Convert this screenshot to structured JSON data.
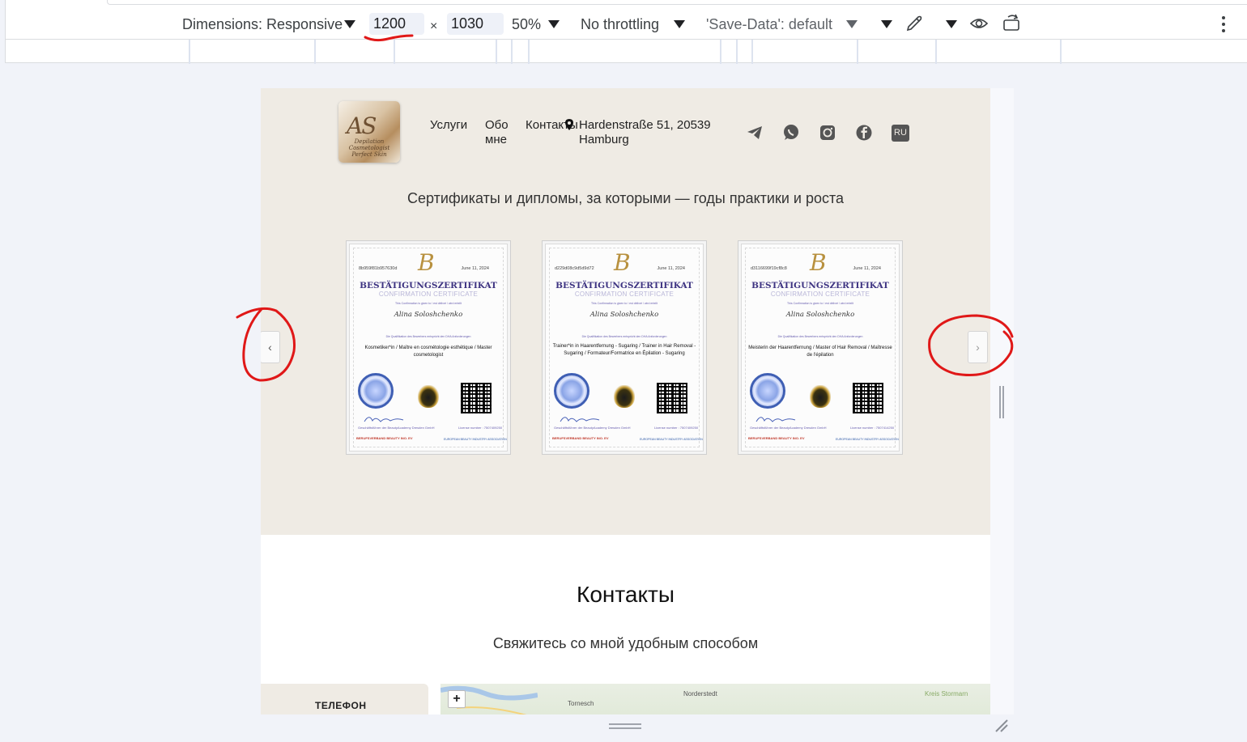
{
  "devtools": {
    "dimensions_label": "Dimensions: Responsive",
    "width_value": "1200",
    "times": "×",
    "height_value": "1030",
    "zoom": "50%",
    "throttling": "No throttling",
    "save_data": "'Save-Data': default"
  },
  "site": {
    "nav": {
      "services": "Услуги",
      "about_line1": "Обо",
      "about_line2": "мне",
      "contacts": "Контакты",
      "address_line1": "Hardenstraße 51, 20539",
      "address_line2": "Hamburg",
      "lang": "RU"
    },
    "logo": {
      "monogram": "AS",
      "tagline": "Depilation Cosmetologist Perfect Skin"
    },
    "hero_subtitle": "Сертификаты и дипломы, за которыми — годы практики и роста",
    "certificates": [
      {
        "code": "8b959f81b957630d",
        "date": "June 11, 2024",
        "title": "BESTÄTIGUNGSZERTIFIKAT",
        "subtitle": "CONFIRMATION CERTIFICATE",
        "given": "This Confirmation is given to / est délivré / wird erteilt",
        "name": "Alina Soloshchenko",
        "dqr": "Die Qualifikation des Bewerbers entspricht den DHA Anforderungen",
        "qualification": "Kosmetiker*in / Maître en cosmétologie esthétique / Master cosmetologist",
        "signer": "Geschäftsführer der BeautyAcademy Dresden GmbH",
        "license": "License number : 7507409250",
        "org_left": "BERUFSVERBAND BEAUTY INO. EV",
        "org_right": "EUROPEAN BEAUTY INDUSTRY ASSOCIATION"
      },
      {
        "code": "d229d08c9d5d9d72",
        "date": "June 11, 2024",
        "title": "BESTÄTIGUNGSZERTIFIKAT",
        "subtitle": "CONFIRMATION CERTIFICATE",
        "given": "This Confirmation is given to / est délivré / wird erteilt",
        "name": "Alina Soloshchenko",
        "dqr": "Die Qualifikation des Bewerbers entspricht den DHA Anforderungen",
        "qualification": "Trainer*in in Haarentfernung - Sugaring / Trainer in Hair Removal - Sugaring / Formateur/Formatrice en Épilation - Sugaring",
        "signer": "Geschäftsführer der BeautyAcademy Dresden GmbH",
        "license": "License number : 7507409250",
        "org_left": "BERUFSVERBAND BEAUTY INO. EV",
        "org_right": "EUROPEAN BEAUTY INDUSTRY ASSOCIATION"
      },
      {
        "code": "d3116699f19cf8c8",
        "date": "June 11, 2024",
        "title": "BESTÄTIGUNGSZERTIFIKAT",
        "subtitle": "CONFIRMATION CERTIFICATE",
        "given": "This Confirmation is given to / est délivré / wird erteilt",
        "name": "Alina Soloshchenko",
        "dqr": "Die Qualifikation des Bewerbers entspricht den DHA Anforderungen",
        "qualification": "Meisterin der Haarentfernung / Master of Hair Removal / Maîtresse de l'épilation",
        "signer": "Geschäftsführer der BeautyAcademy Dresden GmbH",
        "license": "License number : 7507414250",
        "org_left": "BERUFSVERBAND BEAUTY INO. EV",
        "org_right": "EUROPEAN BEAUTY INDUSTRY ASSOCIATION"
      }
    ],
    "slider": {
      "prev": "‹",
      "next": "›"
    },
    "contacts_title": "Контакты",
    "contacts_subtitle": "Свяжитесь со мной удобным способом",
    "phone_label": "ТЕЛЕФОН",
    "map": {
      "zoom_in": "+",
      "place_1": "Norderstedt",
      "place_2": "Tornesch",
      "place_3": "Kreis Stormarn"
    }
  },
  "colors": {
    "annotation": "#e01818",
    "hero_bg": "#efebe4",
    "cert_title": "#3e3482",
    "accent_gold": "#b8913f"
  },
  "icons": [
    "chevron-down-icon",
    "eyedropper-icon",
    "eye-icon",
    "rotate-icon",
    "more-vert-icon",
    "location-pin-icon",
    "telegram-icon",
    "whatsapp-icon",
    "instagram-icon",
    "facebook-icon"
  ]
}
